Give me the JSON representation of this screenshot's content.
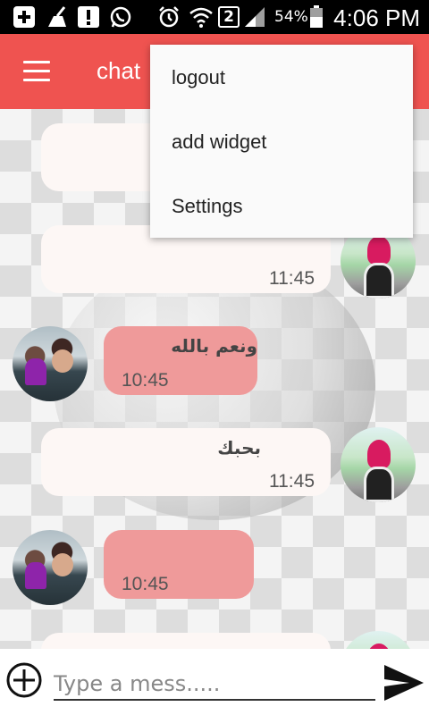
{
  "status_bar": {
    "battery_percent": "54%",
    "time": "4:06 PM",
    "sim_label": "2",
    "icons": [
      "add-box-icon",
      "cleaner-icon",
      "alert-icon",
      "whatsapp-icon",
      "alarm-icon",
      "wifi-icon",
      "sim-icon",
      "signal-icon",
      "battery-icon"
    ]
  },
  "toolbar": {
    "title": "chat",
    "menu_icon": "hamburger-icon"
  },
  "messages": [
    {
      "side": "left",
      "style": "white",
      "text": "",
      "time": ""
    },
    {
      "side": "left",
      "style": "white",
      "text": "",
      "time": "11:45",
      "avatar": "girl"
    },
    {
      "side": "right",
      "style": "pink",
      "text": "ونعم بالله",
      "time": "10:45",
      "avatar": "couple"
    },
    {
      "side": "left",
      "style": "white",
      "text": "بحبك",
      "time": "11:45",
      "avatar": "girl"
    },
    {
      "side": "right",
      "style": "pink",
      "text": "",
      "time": "10:45",
      "avatar": "couple"
    },
    {
      "side": "left",
      "style": "white",
      "text": "",
      "time": "",
      "avatar": "girl"
    }
  ],
  "input": {
    "placeholder": "Type a mess.....",
    "value": ""
  },
  "overflow_menu": {
    "items": [
      "logout",
      "add widget",
      "Settings"
    ]
  },
  "colors": {
    "accent": "#ef5350",
    "bubble_pink": "#ef9a9a",
    "bubble_white": "#fdf7f5"
  }
}
